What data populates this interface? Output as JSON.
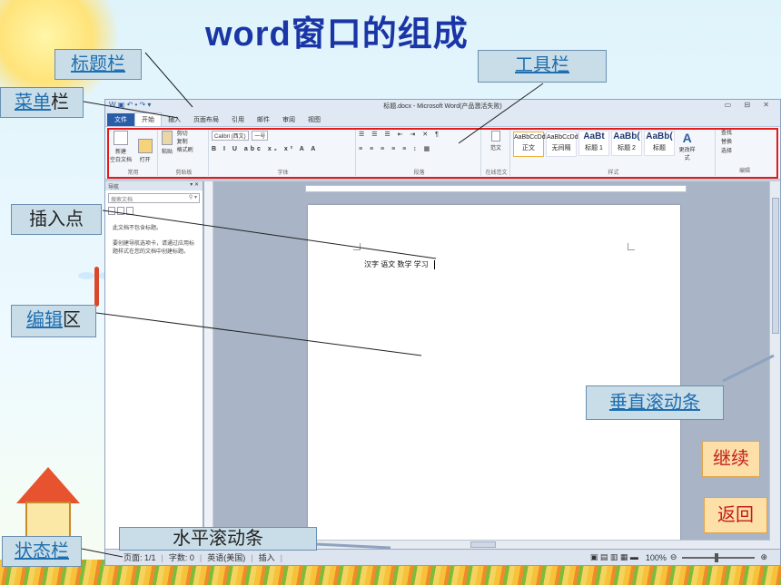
{
  "slide": {
    "title": "word窗口的组成",
    "labels": {
      "titlebar": "标题栏",
      "menubar_link": "菜单",
      "menubar_rest": "栏",
      "toolbar": "工具栏",
      "insertion_point": "插入点",
      "edit_link": "编辑",
      "edit_rest": "区",
      "vscroll": "垂直滚动条",
      "hscroll": "水平滚动条",
      "statusbar": "状态栏"
    },
    "buttons": {
      "continue": "继续",
      "back": "返回"
    }
  },
  "word": {
    "window_title": "标题.docx - Microsoft Word(产品激活失败)",
    "quick_access": "W ▣ ↶ • ↷ ▾",
    "window_controls": "▭ ⊟ ✕",
    "menu": {
      "file": "文件",
      "tabs": [
        "开始",
        "插入",
        "页面布局",
        "引用",
        "邮件",
        "审阅",
        "视图"
      ]
    },
    "ribbon": {
      "groups": {
        "new": "新建\n空白文档",
        "open": "打开",
        "paste": "粘贴",
        "cut": "剪切",
        "copy": "复制",
        "painter": "格式刷",
        "clipboard": "剪贴板",
        "font_name": "Calibri (西文)",
        "font_size": "一号",
        "font_group": "字体",
        "paragraph_group": "段落",
        "template": "范文",
        "online_template": "在线范文",
        "styles_group": "样式",
        "change_styles": "更改样式",
        "find": "查找",
        "replace": "替换",
        "select": "选择",
        "edit_group": "编辑"
      },
      "styles": [
        {
          "sample": "AaBbCcDd",
          "name": "正文"
        },
        {
          "sample": "AaBbCcDd",
          "name": "无间隔"
        },
        {
          "sample": "AaBt",
          "name": "标题 1"
        },
        {
          "sample": "AaBb(",
          "name": "标题 2"
        },
        {
          "sample": "AaBb(",
          "name": "标题"
        }
      ]
    },
    "nav": {
      "title": "导航",
      "search_placeholder": "搜索文档",
      "msg1": "此文档不包含标题。",
      "msg2": "要创建导航选项卡，请通过应用标题样式在您的文档中创建标题。"
    },
    "document_text": "汉字 语文 数学 学习",
    "status": {
      "page": "页面: 1/1",
      "words": "字数: 0",
      "lang": "英语(美国)",
      "mode": "插入",
      "zoom": "100%"
    }
  }
}
